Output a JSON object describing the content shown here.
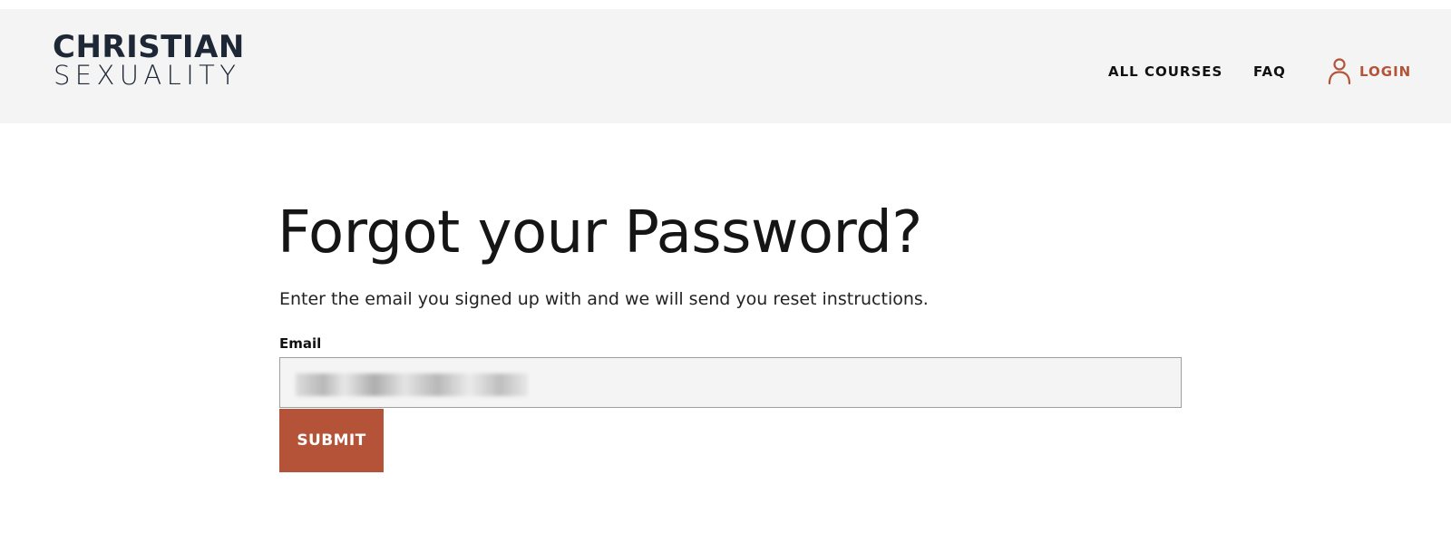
{
  "header": {
    "logo": {
      "line1": "CHRISTIAN",
      "line2": "SEXUALITY"
    },
    "nav": {
      "all_courses": "ALL COURSES",
      "faq": "FAQ",
      "login": "LOGIN",
      "login_icon": "user-icon"
    }
  },
  "main": {
    "title": "Forgot your Password?",
    "description": "Enter the email you signed up with and we will send you reset instructions.",
    "email_label": "Email",
    "email_value": "",
    "submit_label": "SUBMIT"
  },
  "colors": {
    "header_bg": "#f4f4f4",
    "accent": "#b55339",
    "logo": "#1d2735",
    "text": "#151515"
  }
}
